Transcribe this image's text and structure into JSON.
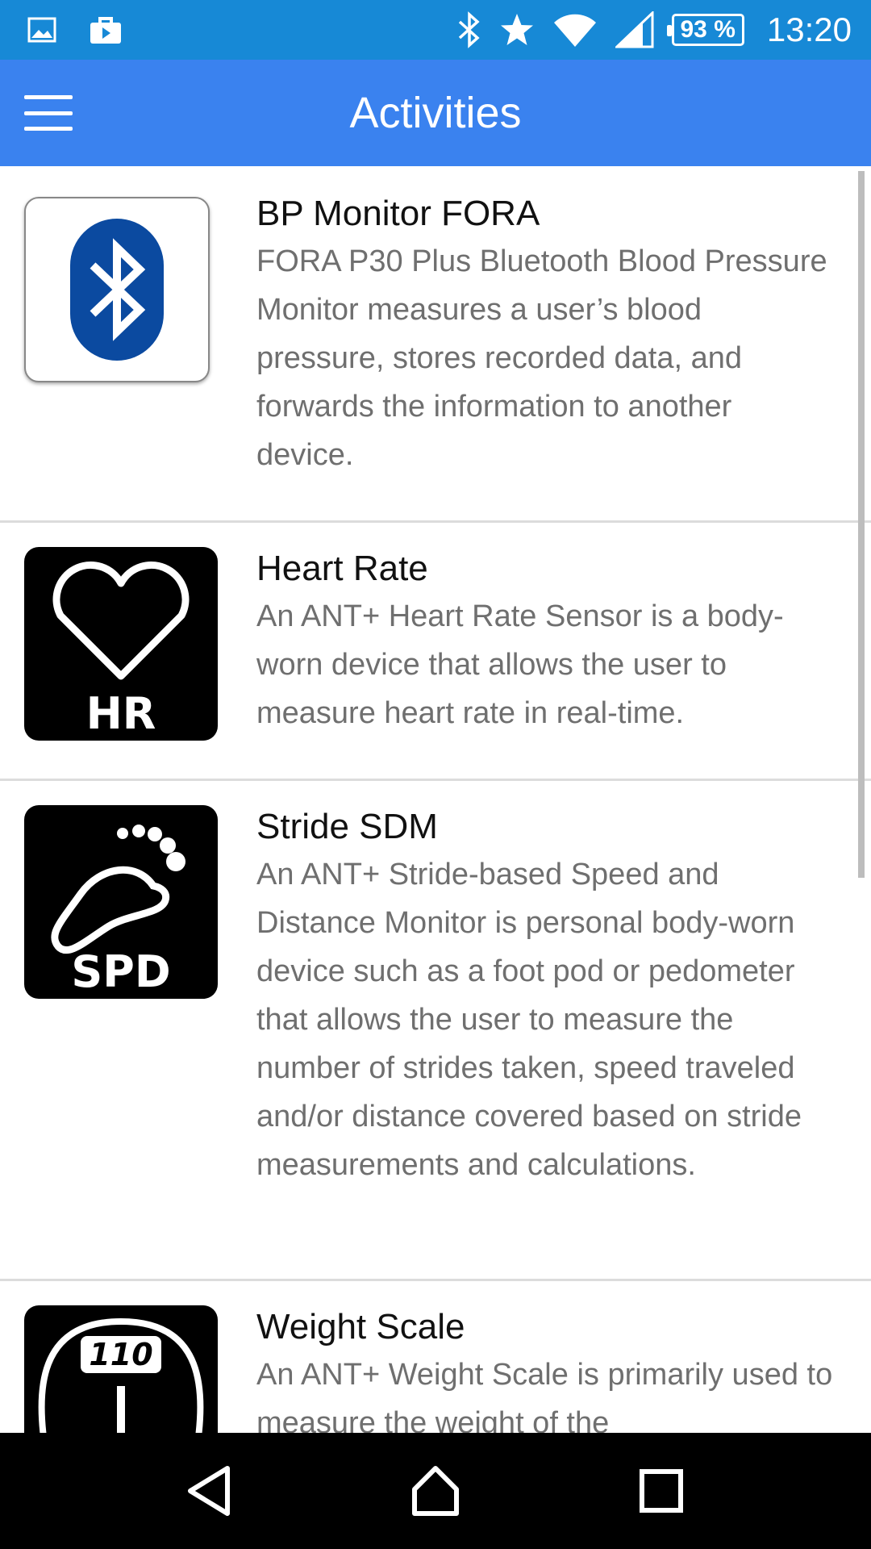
{
  "status_bar": {
    "battery": "93 %",
    "time": "13:20",
    "icons": [
      "gallery-icon",
      "store-icon",
      "bluetooth-icon",
      "star-icon",
      "wifi-icon",
      "signal-icon",
      "battery-icon"
    ]
  },
  "app_bar": {
    "title": "Activities",
    "menu_icon": "hamburger-menu-icon"
  },
  "activities": [
    {
      "title": "BP Monitor FORA",
      "description": "FORA P30 Plus Bluetooth Blood Pressure Monitor measures a user’s blood pressure, stores recorded data, and forwards the information to another device.",
      "icon": "bluetooth-logo"
    },
    {
      "title": "Heart Rate",
      "description": "An ANT+ Heart Rate Sensor is a body-worn device that allows the user to measure heart rate in real-time.",
      "icon": "heart-rate",
      "icon_label": "HR"
    },
    {
      "title": "Stride SDM",
      "description": "An ANT+ Stride-based Speed and Distance Monitor is personal body-worn device such as a foot pod or pedometer that allows the user to measure the number of strides taken, speed traveled and/or distance covered based on stride measurements and calculations.",
      "icon": "footprint",
      "icon_label": "SPD"
    },
    {
      "title": "Weight Scale",
      "description": "An ANT+ Weight Scale is primarily used to measure the weight of the",
      "icon": "scale",
      "icon_label": "110"
    }
  ],
  "nav_bar": {
    "buttons": [
      "back-icon",
      "home-icon",
      "recents-icon"
    ]
  },
  "colors": {
    "status_bar": "#1789d6",
    "app_bar": "#3a82ef",
    "bluetooth_blue": "#0b4aa0"
  }
}
